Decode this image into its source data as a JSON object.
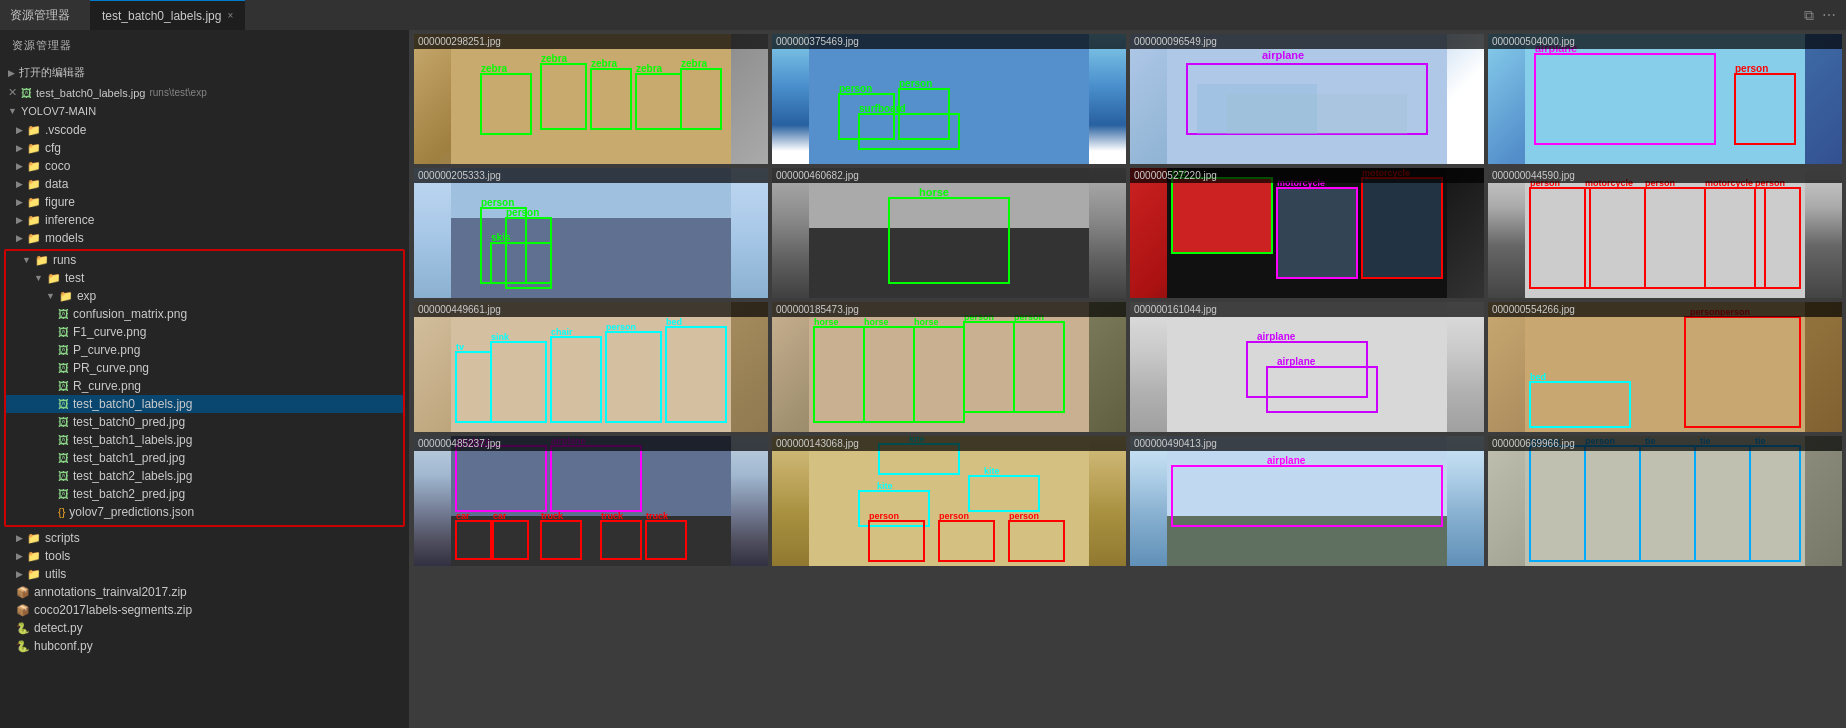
{
  "titlebar": {
    "manager_label": "资源管理器",
    "open_editors_label": "打开的编辑器",
    "tab_filename": "test_batch0_labels.jpg",
    "tab_path": "runs\\test\\exp",
    "close_icon": "×",
    "window_icon1": "⧉",
    "window_icon2": "⋯"
  },
  "sidebar": {
    "root_folder": "YOLOV7-MAIN",
    "items": [
      {
        "name": ".vscode",
        "type": "folder",
        "depth": 1
      },
      {
        "name": "cfg",
        "type": "folder",
        "depth": 1
      },
      {
        "name": "coco",
        "type": "folder",
        "depth": 1
      },
      {
        "name": "data",
        "type": "folder",
        "depth": 1
      },
      {
        "name": "figure",
        "type": "folder",
        "depth": 1
      },
      {
        "name": "inference",
        "type": "folder",
        "depth": 1
      },
      {
        "name": "models",
        "type": "folder",
        "depth": 1
      },
      {
        "name": "runs",
        "type": "folder",
        "depth": 1,
        "expanded": true
      },
      {
        "name": "test",
        "type": "folder",
        "depth": 2,
        "expanded": true
      },
      {
        "name": "exp",
        "type": "folder",
        "depth": 3,
        "expanded": true
      },
      {
        "name": "confusion_matrix.png",
        "type": "image",
        "depth": 4
      },
      {
        "name": "F1_curve.png",
        "type": "image",
        "depth": 4
      },
      {
        "name": "P_curve.png",
        "type": "image",
        "depth": 4
      },
      {
        "name": "PR_curve.png",
        "type": "image",
        "depth": 4
      },
      {
        "name": "R_curve.png",
        "type": "image",
        "depth": 4
      },
      {
        "name": "test_batch0_labels.jpg",
        "type": "image",
        "depth": 4,
        "selected": true
      },
      {
        "name": "test_batch0_pred.jpg",
        "type": "image",
        "depth": 4
      },
      {
        "name": "test_batch1_labels.jpg",
        "type": "image",
        "depth": 4
      },
      {
        "name": "test_batch1_pred.jpg",
        "type": "image",
        "depth": 4
      },
      {
        "name": "test_batch2_labels.jpg",
        "type": "image",
        "depth": 4
      },
      {
        "name": "test_batch2_pred.jpg",
        "type": "image",
        "depth": 4
      },
      {
        "name": "yolov7_predictions.json",
        "type": "json",
        "depth": 4
      },
      {
        "name": "scripts",
        "type": "folder",
        "depth": 1
      },
      {
        "name": "tools",
        "type": "folder",
        "depth": 1
      },
      {
        "name": "utils",
        "type": "folder",
        "depth": 1
      },
      {
        "name": "annotations_trainval2017.zip",
        "type": "zip",
        "depth": 1
      },
      {
        "name": "coco2017labels-segments.zip",
        "type": "zip",
        "depth": 1
      },
      {
        "name": "detect.py",
        "type": "python",
        "depth": 1
      },
      {
        "name": "hubconf.py",
        "type": "python",
        "depth": 1
      }
    ]
  },
  "images": [
    {
      "filename": "000000298251.jpg",
      "bg": "zebra"
    },
    {
      "filename": "000000375469.jpg",
      "bg": "wave"
    },
    {
      "filename": "000000096549.jpg",
      "bg": "plane1"
    },
    {
      "filename": "000000504000.jpg",
      "bg": "plane2"
    },
    {
      "filename": "000000205333.jpg",
      "bg": "sky"
    },
    {
      "filename": "000000460682.jpg",
      "bg": "horse"
    },
    {
      "filename": "000000527220.jpg",
      "bg": "car"
    },
    {
      "filename": "000000044590.jpg",
      "bg": "motorcycle"
    },
    {
      "filename": "000000449661.jpg",
      "bg": "room"
    },
    {
      "filename": "000000185473.jpg",
      "bg": "horses"
    },
    {
      "filename": "000000161044.jpg",
      "bg": "fog"
    },
    {
      "filename": "000000554266.jpg",
      "bg": "bedroom"
    },
    {
      "filename": "000000485237.jpg",
      "bg": "airport"
    },
    {
      "filename": "000000143068.jpg",
      "bg": "kite"
    },
    {
      "filename": "000000490413.jpg",
      "bg": "airplanelong"
    },
    {
      "filename": "000000669966.jpg",
      "bg": "oldphoto"
    }
  ]
}
